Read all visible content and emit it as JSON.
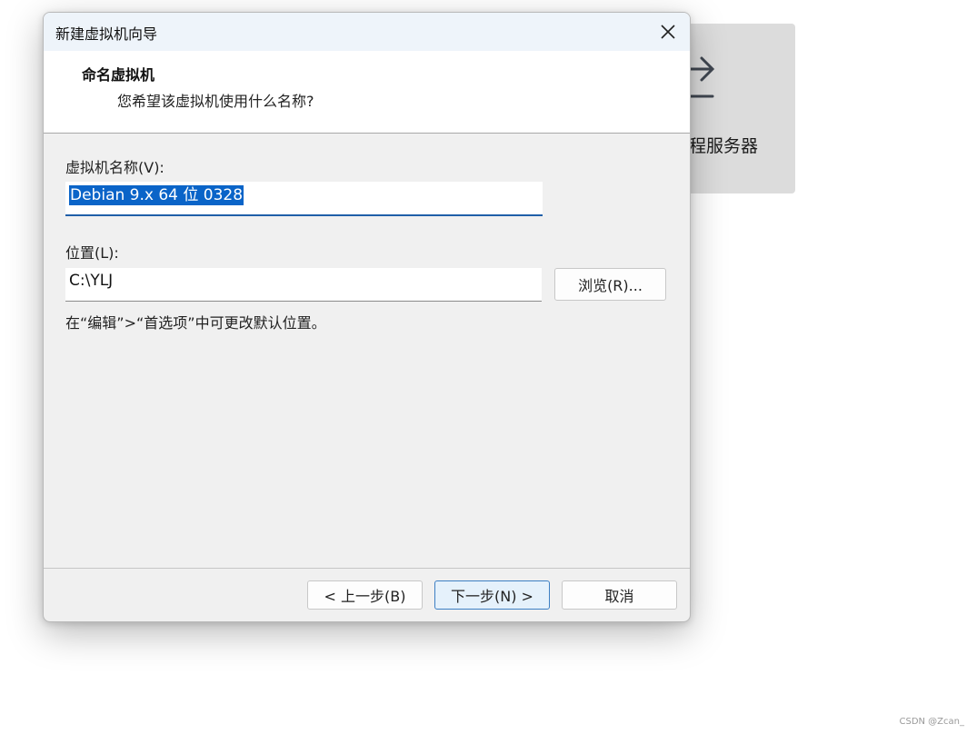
{
  "background": {
    "card_label": "程服务器",
    "card_icon": "arrow-right-icon"
  },
  "dialog": {
    "title": "新建虚拟机向导",
    "close_icon": "close-icon",
    "header": {
      "title": "命名虚拟机",
      "subtitle": "您希望该虚拟机使用什么名称?"
    },
    "name_label": "虚拟机名称(V):",
    "name_value": "Debian 9.x 64 位 0328",
    "location_label": "位置(L):",
    "location_value": "C:\\YLJ",
    "browse_button": "浏览(R)...",
    "hint": "在“编辑”>“首选项”中可更改默认位置。",
    "buttons": {
      "back": "< 上一步(B)",
      "next": "下一步(N) >",
      "cancel": "取消"
    }
  },
  "watermark": "CSDN @Zcan_",
  "colors": {
    "accent": "#0a64c8",
    "titlebar": "#eef4fa",
    "dialog_bg": "#f0f0f0",
    "primary_button": "#e5f1fb"
  }
}
